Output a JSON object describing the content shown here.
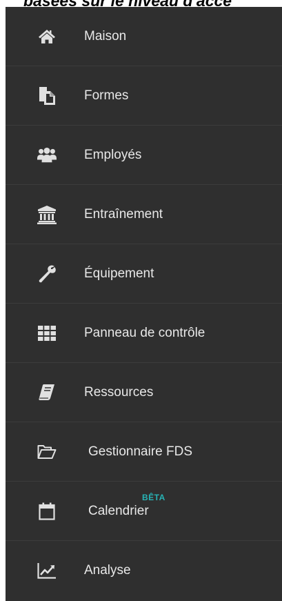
{
  "caption": "basées sur le niveau d'accè",
  "colors": {
    "sidebar_bg": "#2f2f2f",
    "text": "#e8e8e8",
    "beta": "#27b3b5"
  },
  "sidebar": {
    "items": [
      {
        "label": "Maison",
        "icon": "home-icon"
      },
      {
        "label": "Formes",
        "icon": "forms-icon"
      },
      {
        "label": "Employés",
        "icon": "users-icon"
      },
      {
        "label": "Entraînement",
        "icon": "institution-icon"
      },
      {
        "label": "Équipement",
        "icon": "wrench-icon"
      },
      {
        "label": "Panneau de contrôle",
        "icon": "grid-icon"
      },
      {
        "label": "Ressources",
        "icon": "book-icon"
      },
      {
        "label": "Gestionnaire FDS",
        "icon": "folder-open-icon"
      },
      {
        "label": "Calendrier",
        "icon": "calendar-icon",
        "badge": "BÊTA"
      },
      {
        "label": "Analyse",
        "icon": "line-chart-icon"
      }
    ]
  }
}
